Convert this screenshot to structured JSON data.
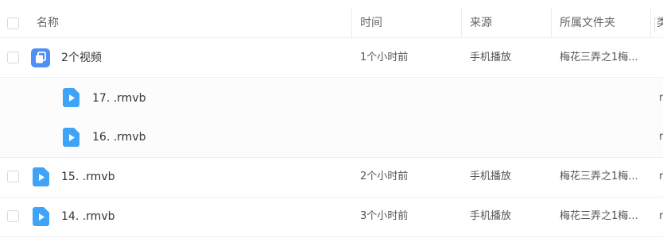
{
  "columns": {
    "name": "名称",
    "time": "时间",
    "source": "来源",
    "folder": "所属文件夹",
    "extra": "类"
  },
  "rows": [
    {
      "name": "2个视频",
      "time": "1个小时前",
      "source": "手机播放",
      "folder": "梅花三弄之1梅...",
      "extra": ""
    },
    {
      "name": "17. .rmvb",
      "time": "",
      "source": "",
      "folder": "",
      "extra": "r"
    },
    {
      "name": "16. .rmvb",
      "time": "",
      "source": "",
      "folder": "",
      "extra": "r"
    },
    {
      "name": "15. .rmvb",
      "time": "2个小时前",
      "source": "手机播放",
      "folder": "梅花三弄之1梅...",
      "extra": "r"
    },
    {
      "name": "14. .rmvb",
      "time": "3个小时前",
      "source": "手机播放",
      "folder": "梅花三弄之1梅...",
      "extra": "r"
    }
  ],
  "colors": {
    "group_icon": "#4d8ff5",
    "video_icon": "#3fa3f7"
  },
  "icons": {
    "group": "video-group-icon",
    "video": "video-file-icon"
  }
}
